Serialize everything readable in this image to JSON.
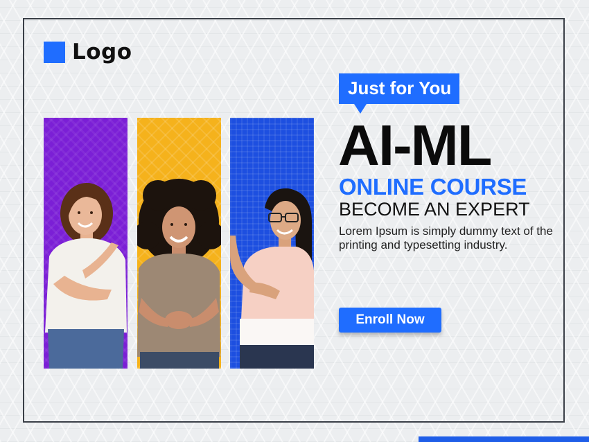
{
  "logo": {
    "text": "Logo",
    "mark_color": "#1f6dff"
  },
  "tag": {
    "text": "Just for You"
  },
  "headline": "AI-ML",
  "subheadline": "ONLINE COURSE",
  "tagline": "BECOME AN EXPERT",
  "description": "Lorem Ipsum is simply dummy text of the printing and typesetting industry.",
  "cta": {
    "label": "Enroll Now"
  },
  "panels": [
    {
      "name": "purple-panel",
      "color": "#7b1fd6",
      "icon": "smiling-woman-photo"
    },
    {
      "name": "yellow-panel",
      "color": "#f5b21c",
      "icon": "smiling-woman-photo"
    },
    {
      "name": "blue-panel",
      "color": "#1d4fe0",
      "icon": "smiling-woman-photo"
    }
  ],
  "accent_color": "#1f6dff"
}
